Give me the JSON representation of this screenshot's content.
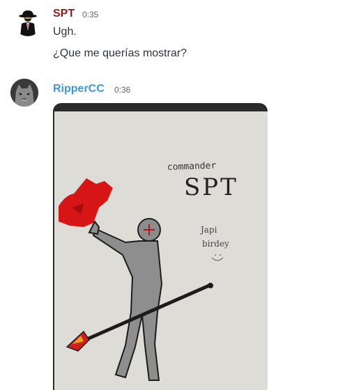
{
  "messages": [
    {
      "author": "SPT",
      "author_color": "#8b1a1a",
      "avatar_icon": "fedora-agent-icon",
      "timestamp": "0:35",
      "lines": [
        "Ugh.",
        "¿Que me querías mostrar?"
      ]
    },
    {
      "author": "RipperCC",
      "author_color": "#3e97d6",
      "avatar_icon": "wolf-mask-icon",
      "timestamp": "0:36",
      "attachment": {
        "kind": "image",
        "handwriting": [
          "commander",
          "SPT",
          "Japi",
          "birdey"
        ]
      }
    }
  ]
}
